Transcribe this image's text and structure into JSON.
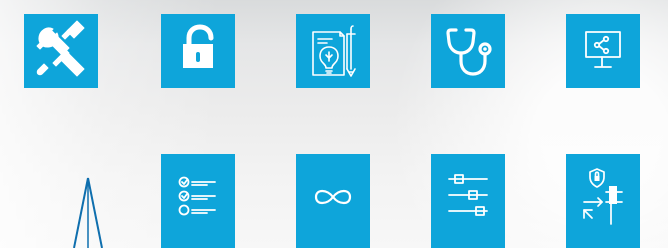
{
  "colors": {
    "tile": "#0ea5da",
    "icon": "#ffffff",
    "background_top": "#d9dbdc",
    "background_bottom": "#f7f7f7",
    "spire": "#0f6fae"
  },
  "icons": [
    {
      "name": "tools-icon"
    },
    {
      "name": "unlock-icon"
    },
    {
      "name": "idea-document-icon"
    },
    {
      "name": "stethoscope-icon"
    },
    {
      "name": "monitor-share-icon"
    },
    {
      "name": "checklist-icon"
    },
    {
      "name": "infinity-icon"
    },
    {
      "name": "slider-controls-icon"
    },
    {
      "name": "security-routing-icon"
    }
  ]
}
